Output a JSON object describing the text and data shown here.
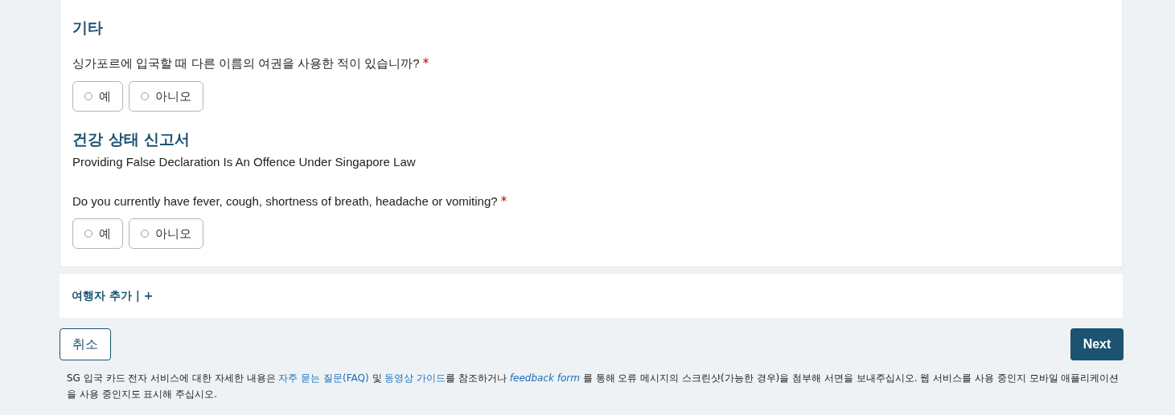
{
  "sections": [
    {
      "title": "기타",
      "questions": [
        {
          "text": "싱가포르에 입국할 때 다른 이름의 여권을 사용한 적이 있습니까?",
          "required": "*",
          "options": [
            {
              "label": "예",
              "selected": false
            },
            {
              "label": "아니오",
              "selected": false
            }
          ]
        }
      ]
    },
    {
      "title": "건강 상태 신고서",
      "subtitle": "Providing False Declaration Is An Offence Under Singapore Law",
      "questions": [
        {
          "text": "Do you currently have fever, cough, shortness of breath, headache or vomiting?",
          "required": "*",
          "options": [
            {
              "label": "예",
              "selected": false
            },
            {
              "label": "아니오",
              "selected": false
            }
          ]
        }
      ]
    }
  ],
  "add_traveller": "여행자 추가 | +",
  "buttons": {
    "cancel": "취소",
    "next": "Next"
  },
  "footer": [
    {
      "kind": "text",
      "text": "SG 입국 카드 전자 서비스에 대한 자세한 내용은 "
    },
    {
      "kind": "link",
      "text": "자주 묻는 질문(FAQ)"
    },
    {
      "kind": "text",
      "text": " 및 "
    },
    {
      "kind": "link",
      "text": "동영상 가이드"
    },
    {
      "kind": "text",
      "text": "를 참조하거나 "
    },
    {
      "kind": "italic_link",
      "text": "feedback form"
    },
    {
      "kind": "text",
      "text": " 를 통해 오류 메시지의 스크린샷(가능한 경우)을 첨부해 서면을 보내주십시오. 웹 서비스를 사용 중인지 모바일 애플리케이션을 사용 중인지도 표시해 주십시오."
    }
  ]
}
